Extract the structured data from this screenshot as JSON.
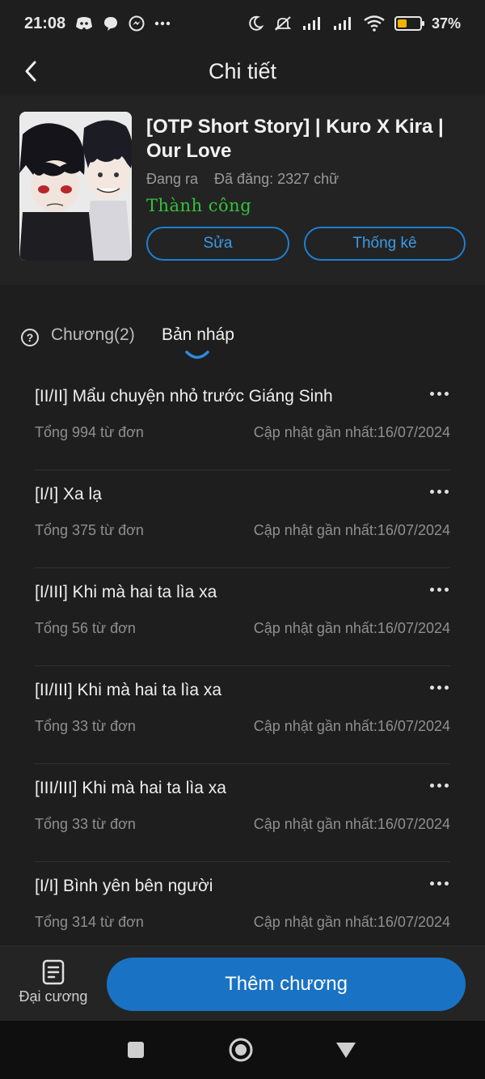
{
  "status_bar": {
    "time": "21:08",
    "battery_percent": "37",
    "battery_pct_label": "37%",
    "battery_level": 0.37,
    "icons": [
      "discord-icon",
      "chat-bubble-icon",
      "messenger-icon",
      "more-icon",
      "moon-icon",
      "mute-vibrate-icon",
      "signal-icon",
      "signal-icon",
      "wifi-icon",
      "battery-icon"
    ]
  },
  "header": {
    "title": "Chi tiết",
    "back_icon": "chevron-left-icon"
  },
  "story": {
    "title": "[OTP Short Story] | Kuro X Kira | Our Love",
    "status": "Đang ra",
    "words": "Đã đăng: 2327 chữ",
    "result": "Thành công",
    "edit_label": "Sửa",
    "stats_label": "Thống kê"
  },
  "tabs": {
    "chapters_label": "Chương(2)",
    "drafts_label": "Bản nháp",
    "active": "drafts"
  },
  "drafts": [
    {
      "title": "[II/II] Mẩu chuyện nhỏ trước Giáng Sinh",
      "count": "Tổng 994 từ đơn",
      "updated": "Cập nhật gần nhất:16/07/2024"
    },
    {
      "title": "[I/I] Xa lạ",
      "count": "Tổng 375 từ đơn",
      "updated": "Cập nhật gần nhất:16/07/2024"
    },
    {
      "title": "[I/III] Khi mà hai ta lìa xa",
      "count": "Tổng 56 từ đơn",
      "updated": "Cập nhật gần nhất:16/07/2024"
    },
    {
      "title": "[II/III] Khi mà hai ta lìa xa",
      "count": "Tổng 33 từ đơn",
      "updated": "Cập nhật gần nhất:16/07/2024"
    },
    {
      "title": "[III/III] Khi mà hai ta lìa xa",
      "count": "Tổng 33 từ đơn",
      "updated": "Cập nhật gần nhất:16/07/2024"
    },
    {
      "title": "[I/I] Bình yên bên người",
      "count": "Tổng 314 từ đơn",
      "updated": "Cập nhật gần nhất:16/07/2024"
    }
  ],
  "bottom": {
    "outline_label": "Đại cương",
    "add_chapter_label": "Thêm chương"
  },
  "colors": {
    "background": "#1e1e1e",
    "accent": "#1a72c4",
    "success": "#34c23c",
    "battery": "#f0b400"
  }
}
